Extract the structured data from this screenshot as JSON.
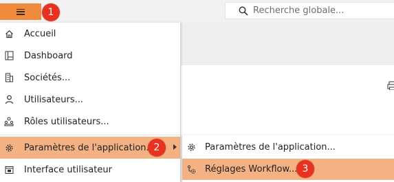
{
  "header": {
    "menu_badge": "1",
    "search_placeholder": "Recherche globale..."
  },
  "menu": {
    "items": [
      {
        "label": "Accueil",
        "icon": "home-icon"
      },
      {
        "label": "Dashboard",
        "icon": "dashboard-icon"
      },
      {
        "label": "Sociétés...",
        "icon": "building-icon"
      },
      {
        "label": "Utilisateurs...",
        "icon": "user-icon"
      },
      {
        "label": "Rôles utilisateurs...",
        "icon": "roles-icon"
      },
      {
        "label": "Paramètres de l'application...",
        "icon": "gear-icon",
        "active": true,
        "badge": "2"
      },
      {
        "label": "Interface utilisateur",
        "icon": "interface-icon"
      }
    ]
  },
  "submenu": {
    "items": [
      {
        "label": "Paramètres de l'application...",
        "icon": "gear-icon"
      },
      {
        "label": "Réglages Workflow...",
        "icon": "workflow-icon",
        "active": true,
        "badge": "3"
      }
    ]
  },
  "colors": {
    "accent_orange": "#f08a3c",
    "highlight": "#f4b183",
    "badge_red": "#e8321f"
  }
}
